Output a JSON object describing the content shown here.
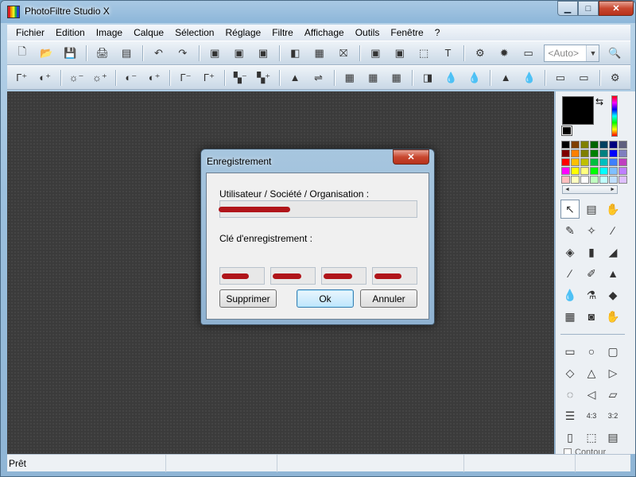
{
  "window": {
    "title": "PhotoFiltre Studio X"
  },
  "caption_buttons": {
    "minimize": "▁",
    "maximize": "□",
    "close": "✕"
  },
  "menu": [
    "Fichier",
    "Edition",
    "Image",
    "Calque",
    "Sélection",
    "Réglage",
    "Filtre",
    "Affichage",
    "Outils",
    "Fenêtre",
    "?"
  ],
  "toolbar1": {
    "icons": [
      "new-file-icon",
      "open-folder-icon",
      "save-icon",
      "|",
      "print-icon",
      "scanner-icon",
      "|",
      "undo-icon",
      "redo-icon",
      "|",
      "paste-icon",
      "copy-layer-icon",
      "export-icon",
      "|",
      "gradient-icon",
      "pattern-icon",
      "frame-icon",
      "|",
      "automation-icon",
      "text-icon",
      "selection-icon",
      "text-tool-icon",
      "|",
      "plugin-icon",
      "effects-icon",
      "window-icon"
    ],
    "glyphs": [
      "🗋",
      "📂",
      "💾",
      "|",
      "🖨",
      "▤",
      "|",
      "↶",
      "↷",
      "|",
      "▣",
      "▣",
      "▣",
      "|",
      "◧",
      "▦",
      "⛝",
      "|",
      "▣",
      "▣",
      "⬚",
      "T",
      "|",
      "⚙",
      "✹",
      "▭"
    ],
    "zoom_select": {
      "value": "<Auto>",
      "arrow": "▼"
    },
    "zoom_icon": "🔍"
  },
  "toolbar2": {
    "glyphs": [
      "Γ⁺",
      "◐⁺",
      "|",
      "☼⁻",
      "☼⁺",
      "|",
      "◐⁻",
      "◐⁺",
      "|",
      "Γ⁻",
      "Γ⁺",
      "|",
      "▚⁻",
      "▚⁺",
      "|",
      "▲",
      "⇌",
      "|",
      "▦",
      "▦",
      "▦",
      "|",
      "◨",
      "💧",
      "💧",
      "|",
      "▲",
      "💧",
      "|",
      "▭",
      "▭",
      "|",
      "⚙"
    ],
    "icons": [
      "gamma-auto-icon",
      "contrast-auto-icon",
      "|",
      "brightness-minus-icon",
      "brightness-plus-icon",
      "|",
      "contrast-minus-icon",
      "contrast-plus-icon",
      "|",
      "gamma-minus-icon",
      "gamma-plus-icon",
      "|",
      "saturation-minus-icon",
      "saturation-plus-icon",
      "|",
      "histogram-icon",
      "balance-icon",
      "|",
      "filter1-icon",
      "filter2-icon",
      "filter3-icon",
      "|",
      "levels-icon",
      "blur-icon",
      "blur-more-icon",
      "|",
      "sharpen-icon",
      "drop-icon",
      "|",
      "resize-icon",
      "canvas-icon",
      "|",
      "transform-icon"
    ]
  },
  "palette": {
    "fg_color": "#000000",
    "swap_glyph": "⇆",
    "swatches": [
      "#000000",
      "#7f3f00",
      "#808000",
      "#006400",
      "#003f5f",
      "#00007f",
      "#5f5f7f",
      "#7f0000",
      "#ff7f00",
      "#7f7f00",
      "#008000",
      "#008080",
      "#0000ff",
      "#7f7fbf",
      "#ff0000",
      "#ffbf00",
      "#bfbf00",
      "#00bf3f",
      "#00bfbf",
      "#3f7fff",
      "#bf3fbf",
      "#ff00ff",
      "#ffff00",
      "#ffff7f",
      "#00ff00",
      "#00ffff",
      "#7fbfff",
      "#bf7fff",
      "#ffbfbf",
      "#ffffbf",
      "#ffffff",
      "#bfffbf",
      "#bfffff",
      "#bfdfff",
      "#dfbfff"
    ],
    "scroll": {
      "left": "◄",
      "right": "►"
    },
    "tools": [
      {
        "glyph": "↖",
        "icon": "pointer-icon",
        "active": true
      },
      {
        "glyph": "▤",
        "icon": "layer-manager-icon"
      },
      {
        "glyph": "✋",
        "icon": "hand-icon"
      },
      {
        "glyph": "✎",
        "icon": "eyedropper-icon"
      },
      {
        "glyph": "✧",
        "icon": "magic-wand-icon"
      },
      {
        "glyph": "∕",
        "icon": "line-icon"
      },
      {
        "glyph": "◈",
        "icon": "fill-icon"
      },
      {
        "glyph": "▮",
        "icon": "spray-icon"
      },
      {
        "glyph": "◢",
        "icon": "eraser-icon"
      },
      {
        "glyph": "∕",
        "icon": "brush-icon"
      },
      {
        "glyph": "✐",
        "icon": "advanced-brush-icon"
      },
      {
        "glyph": "▲",
        "icon": "stamp-icon"
      },
      {
        "glyph": "💧",
        "icon": "blur-tool-icon"
      },
      {
        "glyph": "⚗",
        "icon": "smudge-icon"
      },
      {
        "glyph": "◆",
        "icon": "sponge-icon"
      },
      {
        "glyph": "▦",
        "icon": "pattern-tool-icon"
      },
      {
        "glyph": "◙",
        "icon": "clone-icon"
      },
      {
        "glyph": "✋",
        "icon": "deform-icon"
      }
    ],
    "shapes": [
      {
        "glyph": "▭",
        "icon": "rectangle-icon"
      },
      {
        "glyph": "○",
        "icon": "ellipse-icon"
      },
      {
        "glyph": "▢",
        "icon": "rounded-rect-icon"
      },
      {
        "glyph": "◇",
        "icon": "diamond-icon"
      },
      {
        "glyph": "△",
        "icon": "triangle-icon"
      },
      {
        "glyph": "▷",
        "icon": "triangle-right-icon"
      },
      {
        "glyph": "◌",
        "icon": "lasso-icon"
      },
      {
        "glyph": "◁",
        "icon": "polygon-icon"
      },
      {
        "glyph": "▱",
        "icon": "shape-extra-icon"
      },
      {
        "glyph": "☰",
        "icon": "list-icon"
      },
      {
        "glyph": "4:3",
        "icon": "ratio-4-3-icon"
      },
      {
        "glyph": "3:2",
        "icon": "ratio-3-2-icon"
      },
      {
        "glyph": "▯",
        "icon": "portrait-icon"
      },
      {
        "glyph": "⬚",
        "icon": "selection-box-icon"
      },
      {
        "glyph": "▤",
        "icon": "panel-icon"
      }
    ],
    "contour_label": "Contour"
  },
  "status": {
    "text": "Prêt"
  },
  "dialog": {
    "title": "Enregistrement",
    "close": "✕",
    "user_label": "Utilisateur / Société / Organisation :",
    "key_label": "Clé d'enregistrement :",
    "buttons": {
      "delete": "Supprimer",
      "ok": "Ok",
      "cancel": "Annuler"
    }
  }
}
